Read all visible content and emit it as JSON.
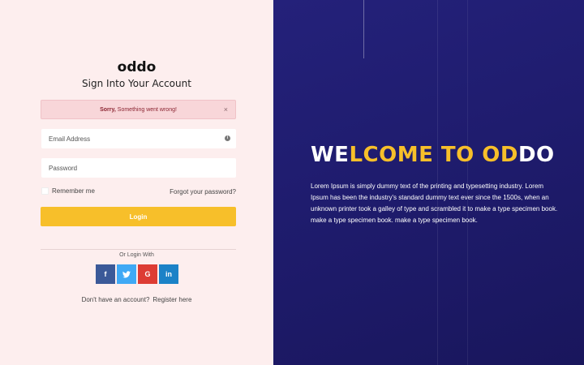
{
  "brand": {
    "logo": "oddo"
  },
  "login": {
    "title": "Sign Into Your Account",
    "alert": {
      "strong": "Sorry,",
      "message": "Something went wrong!",
      "close": "×"
    },
    "email_placeholder": "Email Address",
    "password_placeholder": "Password",
    "remember_label": "Remember me",
    "forgot_label": "Forgot your password?",
    "login_button": "Login",
    "or_text": "Or Login With",
    "social": [
      {
        "name": "facebook",
        "glyph": "f",
        "color": "#3b5998"
      },
      {
        "name": "twitter",
        "glyph": "t",
        "color": "#3fa9f5"
      },
      {
        "name": "google",
        "glyph": "G",
        "color": "#dd3c34"
      },
      {
        "name": "linkedin",
        "glyph": "in",
        "color": "#1b82c7"
      }
    ],
    "no_account_text": "Don't have an account?",
    "register_link": "Register here"
  },
  "hero": {
    "welcome_parts": [
      "WE",
      "LCOME TO ",
      "OD",
      "DO"
    ],
    "paragraph": "Lorem Ipsum is simply dummy text of the printing and typesetting industry. Lorem Ipsum has been the industry's standard dummy text ever since the 1500s, when an unknown printer took a galley of type and scrambled it to make a type specimen book. make a type specimen book. make a type specimen book."
  },
  "colors": {
    "accent": "#f7bf2a",
    "left_bg": "#fdeeee",
    "right_bg": "#1f1c6e"
  }
}
